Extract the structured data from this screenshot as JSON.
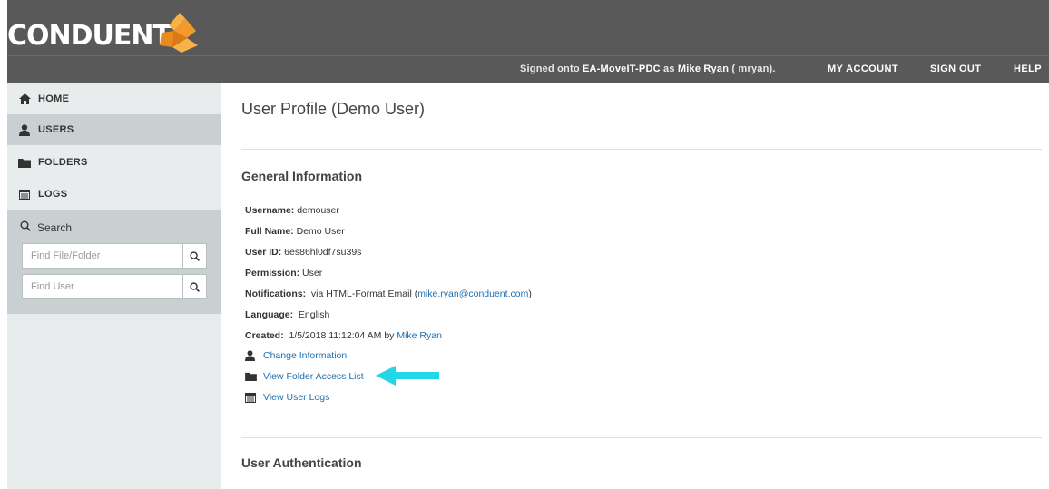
{
  "brand": {
    "logo_text": "CONDUENT"
  },
  "header": {
    "signed_prefix": "Signed onto",
    "signed_server": "EA-MoveIT-PDC",
    "signed_as": "as",
    "signed_user": "Mike Ryan",
    "signed_suffix": "( mryan).",
    "my_account": "MY ACCOUNT",
    "sign_out": "SIGN OUT",
    "help": "HELP"
  },
  "sidebar": {
    "items": [
      {
        "label": "HOME",
        "icon": "home-icon"
      },
      {
        "label": "USERS",
        "icon": "user-icon"
      },
      {
        "label": "FOLDERS",
        "icon": "folder-icon"
      },
      {
        "label": "LOGS",
        "icon": "log-icon"
      }
    ],
    "active_index": 1,
    "search": {
      "title": "Search",
      "file_placeholder": "Find File/Folder",
      "user_placeholder": "Find User"
    }
  },
  "main": {
    "title": "User Profile (Demo User)",
    "general_title": "General Information",
    "fields": [
      {
        "label": "Username:",
        "value": " demouser"
      },
      {
        "label": "Full Name:",
        "value": " Demo User"
      },
      {
        "label": "User ID:",
        "value": " 6es86hl0df7su39s"
      },
      {
        "label": "Permission:",
        "value": " User"
      }
    ],
    "notifications": {
      "label": "Notifications:",
      "value": "  via HTML-Format Email (",
      "email": "mike.ryan@conduent.com",
      "suffix": ")"
    },
    "language": {
      "label": "Language:",
      "value": "  English"
    },
    "created": {
      "label": "Created:",
      "value": "  1/5/2018 11:12:04 AM by ",
      "by": "Mike Ryan"
    },
    "actions": [
      {
        "label": "Change Information",
        "icon": "user-icon"
      },
      {
        "label": "View Folder Access List",
        "icon": "folder-icon"
      },
      {
        "label": "View User Logs",
        "icon": "log-icon"
      }
    ],
    "auth_title": "User Authentication"
  },
  "colors": {
    "header": "#595959",
    "sidebar": "#e9eced",
    "active": "#c8d0d2",
    "link": "#1f6fb0",
    "arrow": "#22d8e8",
    "logo_orange": "#f29a2e"
  }
}
